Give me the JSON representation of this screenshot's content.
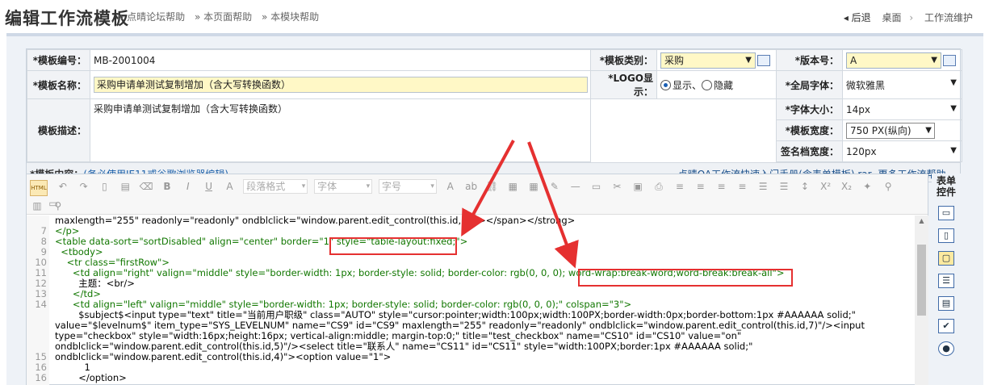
{
  "header": {
    "title": "编辑工作流模板",
    "links": [
      "» 点晴论坛帮助",
      "» 本页面帮助",
      "» 本模块帮助"
    ],
    "back_label": "◂ 后退",
    "nav": [
      "桌面",
      "›",
      "工作流维护"
    ]
  },
  "form": {
    "row1": {
      "label_code": "*模板编号：",
      "code_value": "MB-2001004",
      "label_category": "*模板类别：",
      "category_value": "采购",
      "label_version": "*版本号：",
      "version_value": "A"
    },
    "row2": {
      "label_name": "*模板名称：",
      "name_value": "采购申请单测试复制增加（含大写转换函数）",
      "label_logo": "*LOGO显示：",
      "logo_show": "显示、",
      "logo_hide": "隐藏",
      "label_font": "*全局字体：",
      "font_value": "微软雅黑"
    },
    "row3": {
      "label_desc": "模板描述：",
      "desc_value": "采购申请单测试复制增加（含大写转换函数）",
      "label_size": "*字体大小：",
      "size_value": "14px",
      "label_width": "*模板宽度：",
      "width_value": "750 PX(纵向)",
      "label_sign": "签名档宽度：",
      "sign_value": "120px"
    },
    "content_bar": {
      "label": "*模板内容：",
      "note": "(务必使用IE11或谷歌浏览器编辑)",
      "link1": "点晴OA工作流快速入门手册(含表单模板).rar",
      "link2": "更多工作流帮助..."
    }
  },
  "toolbar": {
    "html_label": "HTML",
    "paragraph": "段落格式",
    "font": "字体",
    "size": "字号"
  },
  "editor": {
    "line_numbers": [
      "",
      "7",
      "8",
      "9",
      "10",
      "11",
      "12",
      "13",
      "14",
      "",
      "",
      "",
      "",
      "15",
      "16"
    ],
    "code_lines": [
      "maxlength=\"255\" readonly=\"readonly\" ondblclick=\"window.parent.edit_control(this.id,7)\"/></span></strong>",
      "</p>",
      "<table data-sort=\"sortDisabled\" align=\"center\" border=\"1\" style=\"table-layout:fixed;\">",
      "  <tbody>",
      "    <tr class=\"firstRow\">",
      "      <td align=\"right\" valign=\"middle\" style=\"border-width: 1px; border-style: solid; border-color: rgb(0, 0, 0); word-wrap:break-word;word-break:break-all\">",
      "        主题：<br/>",
      "      </td>",
      "      <td align=\"left\" valign=\"middle\" style=\"border-width: 1px; border-style: solid; border-color: rgb(0, 0, 0);\" colspan=\"3\">",
      "        $subject$<input type=\"text\" title=\"当前用户职级\" class=\"AUTO\" style=\"cursor:pointer;width:100px;width:100PX;border-width:0px;border-bottom:1px #AAAAAA solid;\"",
      "value=\"$levelnum$\" item_type=\"SYS_LEVELNUM\" name=\"CS9\" id=\"CS9\" maxlength=\"255\" readonly=\"readonly\" ondblclick=\"window.parent.edit_control(this.id,7)\"/><input",
      "type=\"checkbox\" style=\"width:16px;height:16px; vertical-align:middle; margin-top:0;\" title=\"test_checkbox\" name=\"CS10\" id=\"CS10\" value=\"on\"",
      "ondblclick=\"window.parent.edit_control(this.id,5)\"/><select title=\"联系人\" name=\"CS11\" id=\"CS11\" style=\"width:100PX;border:1px #AAAAAA solid;\"",
      "ondblclick=\"window.parent.edit_control(this.id,4)\"><option value=\"1\">",
      "          1",
      "        </option>"
    ]
  },
  "side_panel": {
    "title_line1": "表单",
    "title_line2": "控件"
  },
  "colors": {
    "highlight": "#e53030",
    "required": "#dd0000",
    "yellow_field": "#fff8c6"
  }
}
